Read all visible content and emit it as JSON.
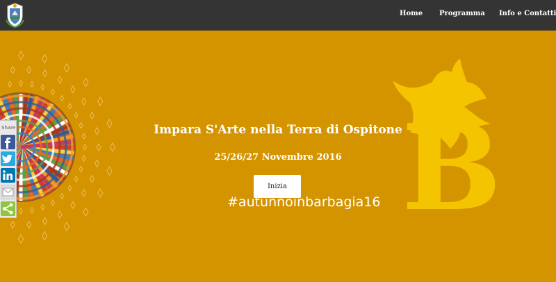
{
  "header": {
    "logo_alt": "Stemma comunale",
    "nav": [
      {
        "label": "Home"
      },
      {
        "label": "Programma"
      },
      {
        "label": "Info e Contatti"
      }
    ]
  },
  "hero": {
    "title": "Impara S'Arte nella Terra di Ospitone",
    "date": "25/26/27 Novembre 2016",
    "button_label": "Inizia",
    "hashtag": "#autunnoinbarbagia16",
    "brand_letter": "B"
  },
  "share_bar": {
    "label": "Share",
    "buttons": [
      {
        "icon": "facebook-icon",
        "color": "#3b5998"
      },
      {
        "icon": "twitter-icon",
        "color": "#2ba9e1"
      },
      {
        "icon": "linkedin-icon",
        "color": "#0077b5"
      },
      {
        "icon": "email-icon",
        "color": "#e2e2e2"
      },
      {
        "icon": "share-icon",
        "color": "#8dc63f"
      }
    ]
  },
  "colors": {
    "topbar": "#343434",
    "hero_background": "#d49400",
    "brand_yellow": "#f5c400"
  }
}
